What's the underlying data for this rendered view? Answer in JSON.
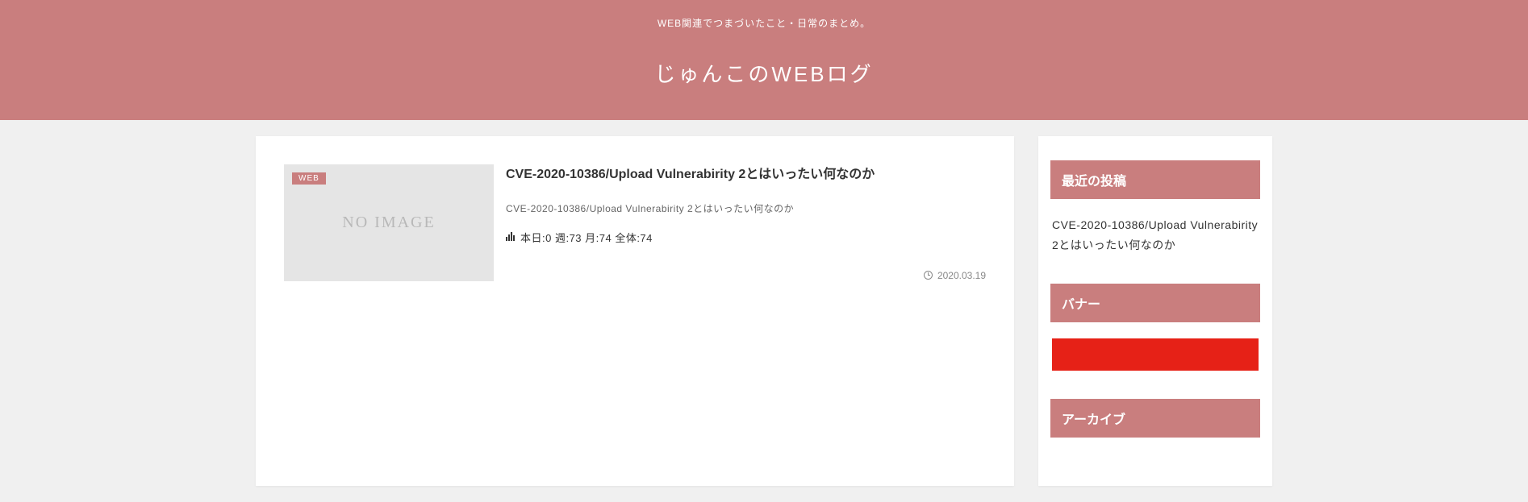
{
  "header": {
    "subtitle": "WEB関連でつまづいたこと・日常のまとめ。",
    "title": "じゅんこのWEBログ"
  },
  "article": {
    "category": "WEB",
    "thumb_text": "NO IMAGE",
    "title": "CVE-2020-10386/Upload Vulnerabirity 2とはいったい何なのか",
    "excerpt": "CVE-2020-10386/Upload Vulnerabirity 2とはいったい何なのか",
    "stats": "本日:0 週:73 月:74 全体:74",
    "date": "2020.03.19"
  },
  "sidebar": {
    "recent_posts": {
      "title": "最近の投稿",
      "items": [
        "CVE-2020-10386/Upload Vulnerabirity 2とはいったい何なのか"
      ]
    },
    "banner": {
      "title": "バナー"
    },
    "archive": {
      "title": "アーカイブ"
    }
  }
}
